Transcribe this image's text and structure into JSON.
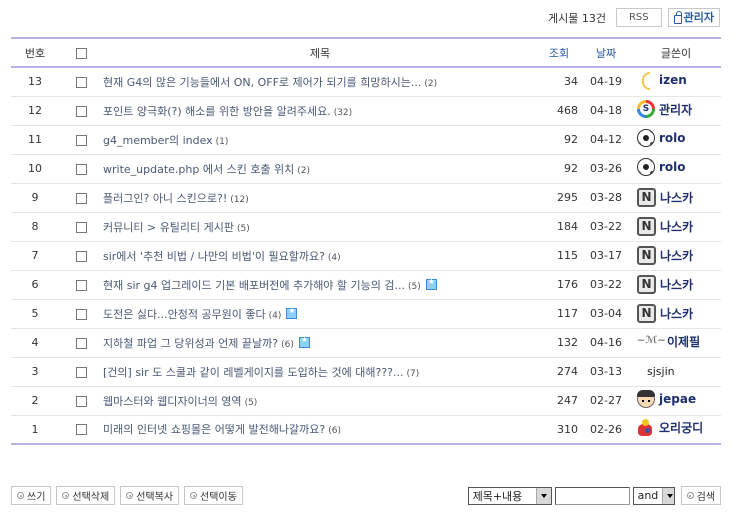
{
  "header": {
    "post_count": "게시물 13건",
    "rss_label": "RSS",
    "admin_label": "관리자"
  },
  "columns": {
    "num": "번호",
    "title": "제목",
    "hit": "조회",
    "date": "날짜",
    "writer": "글쓴이"
  },
  "rows": [
    {
      "num": "13",
      "title": "현재 G4의 많은 기능들에서 ON, OFF로 제어가 되기를 희망하시는...",
      "comments": "(2)",
      "hit": "34",
      "date": "04-19",
      "writer": "izen",
      "icon": "izen-icon",
      "has_icon": false
    },
    {
      "num": "12",
      "title": "포인트 양극화(?) 해소를 위한 방안을 알려주세요.",
      "comments": "(32)",
      "hit": "468",
      "date": "04-18",
      "writer": "관리자",
      "icon": "sir-logo-icon",
      "has_icon": false
    },
    {
      "num": "11",
      "title": "g4_member의 index",
      "comments": "(1)",
      "hit": "92",
      "date": "04-12",
      "writer": "rolo",
      "icon": "soccer-ball-icon",
      "has_icon": false
    },
    {
      "num": "10",
      "title": "write_update.php 에서 스킨 호출 위치",
      "comments": "(2)",
      "hit": "92",
      "date": "03-26",
      "writer": "rolo",
      "icon": "soccer-ball-icon",
      "has_icon": false
    },
    {
      "num": "9",
      "title": "플러그인? 아니 스킨으로?!",
      "comments": "(12)",
      "hit": "295",
      "date": "03-28",
      "writer": "나스카",
      "icon": "n-badge-icon",
      "has_icon": false
    },
    {
      "num": "8",
      "title": "커뮤니티 > 유틸리티 게시판",
      "comments": "(5)",
      "hit": "184",
      "date": "03-22",
      "writer": "나스카",
      "icon": "n-badge-icon",
      "has_icon": false
    },
    {
      "num": "7",
      "title": "sir에서 '추천 비법 / 나만의 비법'이 필요할까요?",
      "comments": "(4)",
      "hit": "115",
      "date": "03-17",
      "writer": "나스카",
      "icon": "n-badge-icon",
      "has_icon": false
    },
    {
      "num": "6",
      "title": "현재 sir g4 업그레이드 기본 배포버전에 추가해야 할 기능의 검...",
      "comments": "(5)",
      "hit": "176",
      "date": "03-22",
      "writer": "나스카",
      "icon": "n-badge-icon",
      "has_icon": true
    },
    {
      "num": "5",
      "title": "도전은 싫다...안정적 공무원이 좋다",
      "comments": "(4)",
      "hit": "117",
      "date": "03-04",
      "writer": "나스카",
      "icon": "n-badge-icon",
      "has_icon": true
    },
    {
      "num": "4",
      "title": "지하철 파업 그 당위성과 언제 끝날까?",
      "comments": "(6)",
      "hit": "132",
      "date": "04-16",
      "writer": "이제필",
      "icon": "signature-icon",
      "has_icon": true
    },
    {
      "num": "3",
      "title": "[건의] sir 도 스쿨과 같이 레벨게이지를 도입하는 것에 대해???...",
      "comments": "(7)",
      "hit": "274",
      "date": "03-13",
      "writer": "sjsjin",
      "icon": "",
      "has_icon": false
    },
    {
      "num": "2",
      "title": "웹마스터와 웹디자이너의 영역",
      "comments": "(5)",
      "hit": "247",
      "date": "02-27",
      "writer": "jepae",
      "icon": "face-avatar-icon",
      "has_icon": false
    },
    {
      "num": "1",
      "title": "미래의 인터넷 쇼핑몰은 어떻게 발전해나갈까요?",
      "comments": "(6)",
      "hit": "310",
      "date": "02-26",
      "writer": "오리궁디",
      "icon": "toy-avatar-icon",
      "has_icon": false
    }
  ],
  "footer": {
    "write_label": "쓰기",
    "delete_label": "선택삭제",
    "copy_label": "선택복사",
    "move_label": "선택이동"
  },
  "search": {
    "field_selected": "제목+내용",
    "input_value": "",
    "operator_selected": "and",
    "button_label": "검색"
  }
}
